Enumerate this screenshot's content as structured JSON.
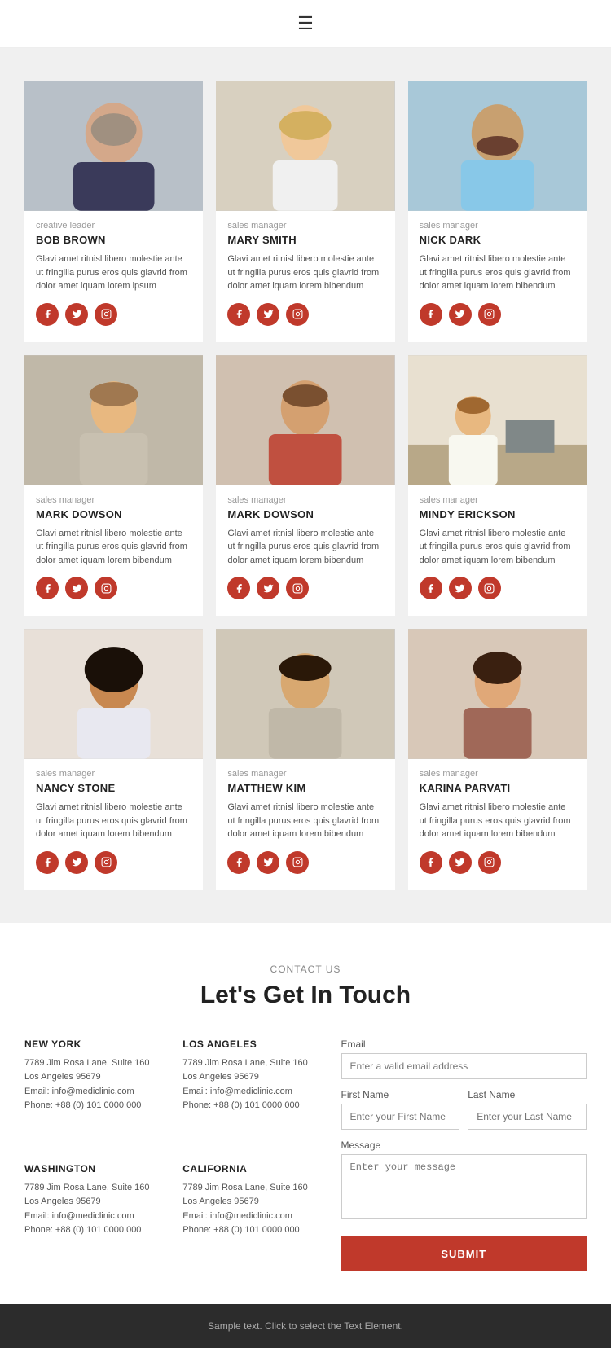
{
  "header": {
    "menu_icon": "☰"
  },
  "team": {
    "members": [
      {
        "role": "creative leader",
        "name": "BOB BROWN",
        "desc": "Glavi amet ritnisl libero molestie ante ut fringilla purus eros quis glavrid from dolor amet iquam lorem ipsum",
        "img_bg": "#b0b8c1",
        "img_label": "Bob Brown"
      },
      {
        "role": "sales manager",
        "name": "MARY SMITH",
        "desc": "Glavi amet ritnisl libero molestie ante ut fringilla purus eros quis glavrid from dolor amet iquam lorem bibendum",
        "img_bg": "#c8bfa8",
        "img_label": "Mary Smith"
      },
      {
        "role": "sales manager",
        "name": "NICK DARK",
        "desc": "Glavi amet ritnisl libero molestie ante ut fringilla purus eros quis glavrid from dolor amet iquam lorem bibendum",
        "img_bg": "#a8c0c8",
        "img_label": "Nick Dark"
      },
      {
        "role": "sales manager",
        "name": "MARK DOWSON",
        "desc": "Glavi amet ritnisl libero molestie ante ut fringilla purus eros quis glavrid from dolor amet iquam lorem bibendum",
        "img_bg": "#b8b0a0",
        "img_label": "Mark Dowson"
      },
      {
        "role": "sales manager",
        "name": "MARK DOWSON",
        "desc": "Glavi amet ritnisl libero molestie ante ut fringilla purus eros quis glavrid from dolor amet iquam lorem bibendum",
        "img_bg": "#c0a898",
        "img_label": "Mark Dowson 2"
      },
      {
        "role": "sales manager",
        "name": "MINDY ERICKSON",
        "desc": "Glavi amet ritnisl libero molestie ante ut fringilla purus eros quis glavrid from dolor amet iquam lorem bibendum",
        "img_bg": "#d8d0c0",
        "img_label": "Mindy Erickson"
      },
      {
        "role": "sales manager",
        "name": "NANCY STONE",
        "desc": "Glavi amet ritnisl libero molestie ante ut fringilla purus eros quis glavrid from dolor amet iquam lorem bibendum",
        "img_bg": "#b0a8b8",
        "img_label": "Nancy Stone"
      },
      {
        "role": "sales manager",
        "name": "MATTHEW KIM",
        "desc": "Glavi amet ritnisl libero molestie ante ut fringilla purus eros quis glavrid from dolor amet iquam lorem bibendum",
        "img_bg": "#c8c0b0",
        "img_label": "Matthew Kim"
      },
      {
        "role": "sales manager",
        "name": "KARINA PARVATI",
        "desc": "Glavi amet ritnisl libero molestie ante ut fringilla purus eros quis glavrid from dolor amet iquam lorem bibendum",
        "img_bg": "#b8a8a0",
        "img_label": "Karina Parvati"
      }
    ]
  },
  "contact": {
    "label": "CONTACT US",
    "title": "Let's Get In Touch",
    "addresses": [
      {
        "city": "NEW YORK",
        "address": "7789 Jim Rosa Lane, Suite 160\nLos Angeles 95679\nEmail: info@mediclinic.com\nPhone: +88 (0) 101 0000 000"
      },
      {
        "city": "LOS ANGELES",
        "address": "7789 Jim Rosa Lane, Suite 160\nLos Angeles 95679\nEmail: info@mediclinic.com\nPhone: +88 (0) 101 0000 000"
      },
      {
        "city": "WASHINGTON",
        "address": "7789 Jim Rosa Lane, Suite 160\nLos Angeles 95679\nEmail: info@mediclinic.com\nPhone: +88 (0) 101 0000 000"
      },
      {
        "city": "CALIFORNIA",
        "address": "7789 Jim Rosa Lane, Suite 160\nLos Angeles 95679\nEmail: info@mediclinic.com\nPhone: +88 (0) 101 0000 000"
      }
    ],
    "form": {
      "email_label": "Email",
      "email_placeholder": "Enter a valid email address",
      "first_name_label": "First Name",
      "first_name_placeholder": "Enter your First Name",
      "last_name_label": "Last Name",
      "last_name_placeholder": "Enter your Last Name",
      "message_label": "Message",
      "message_placeholder": "Enter your message",
      "submit_label": "SUBMIT"
    }
  },
  "footer": {
    "text": "Sample text. Click to select the Text Element."
  },
  "social": {
    "facebook": "f",
    "twitter": "t",
    "instagram": "i"
  }
}
